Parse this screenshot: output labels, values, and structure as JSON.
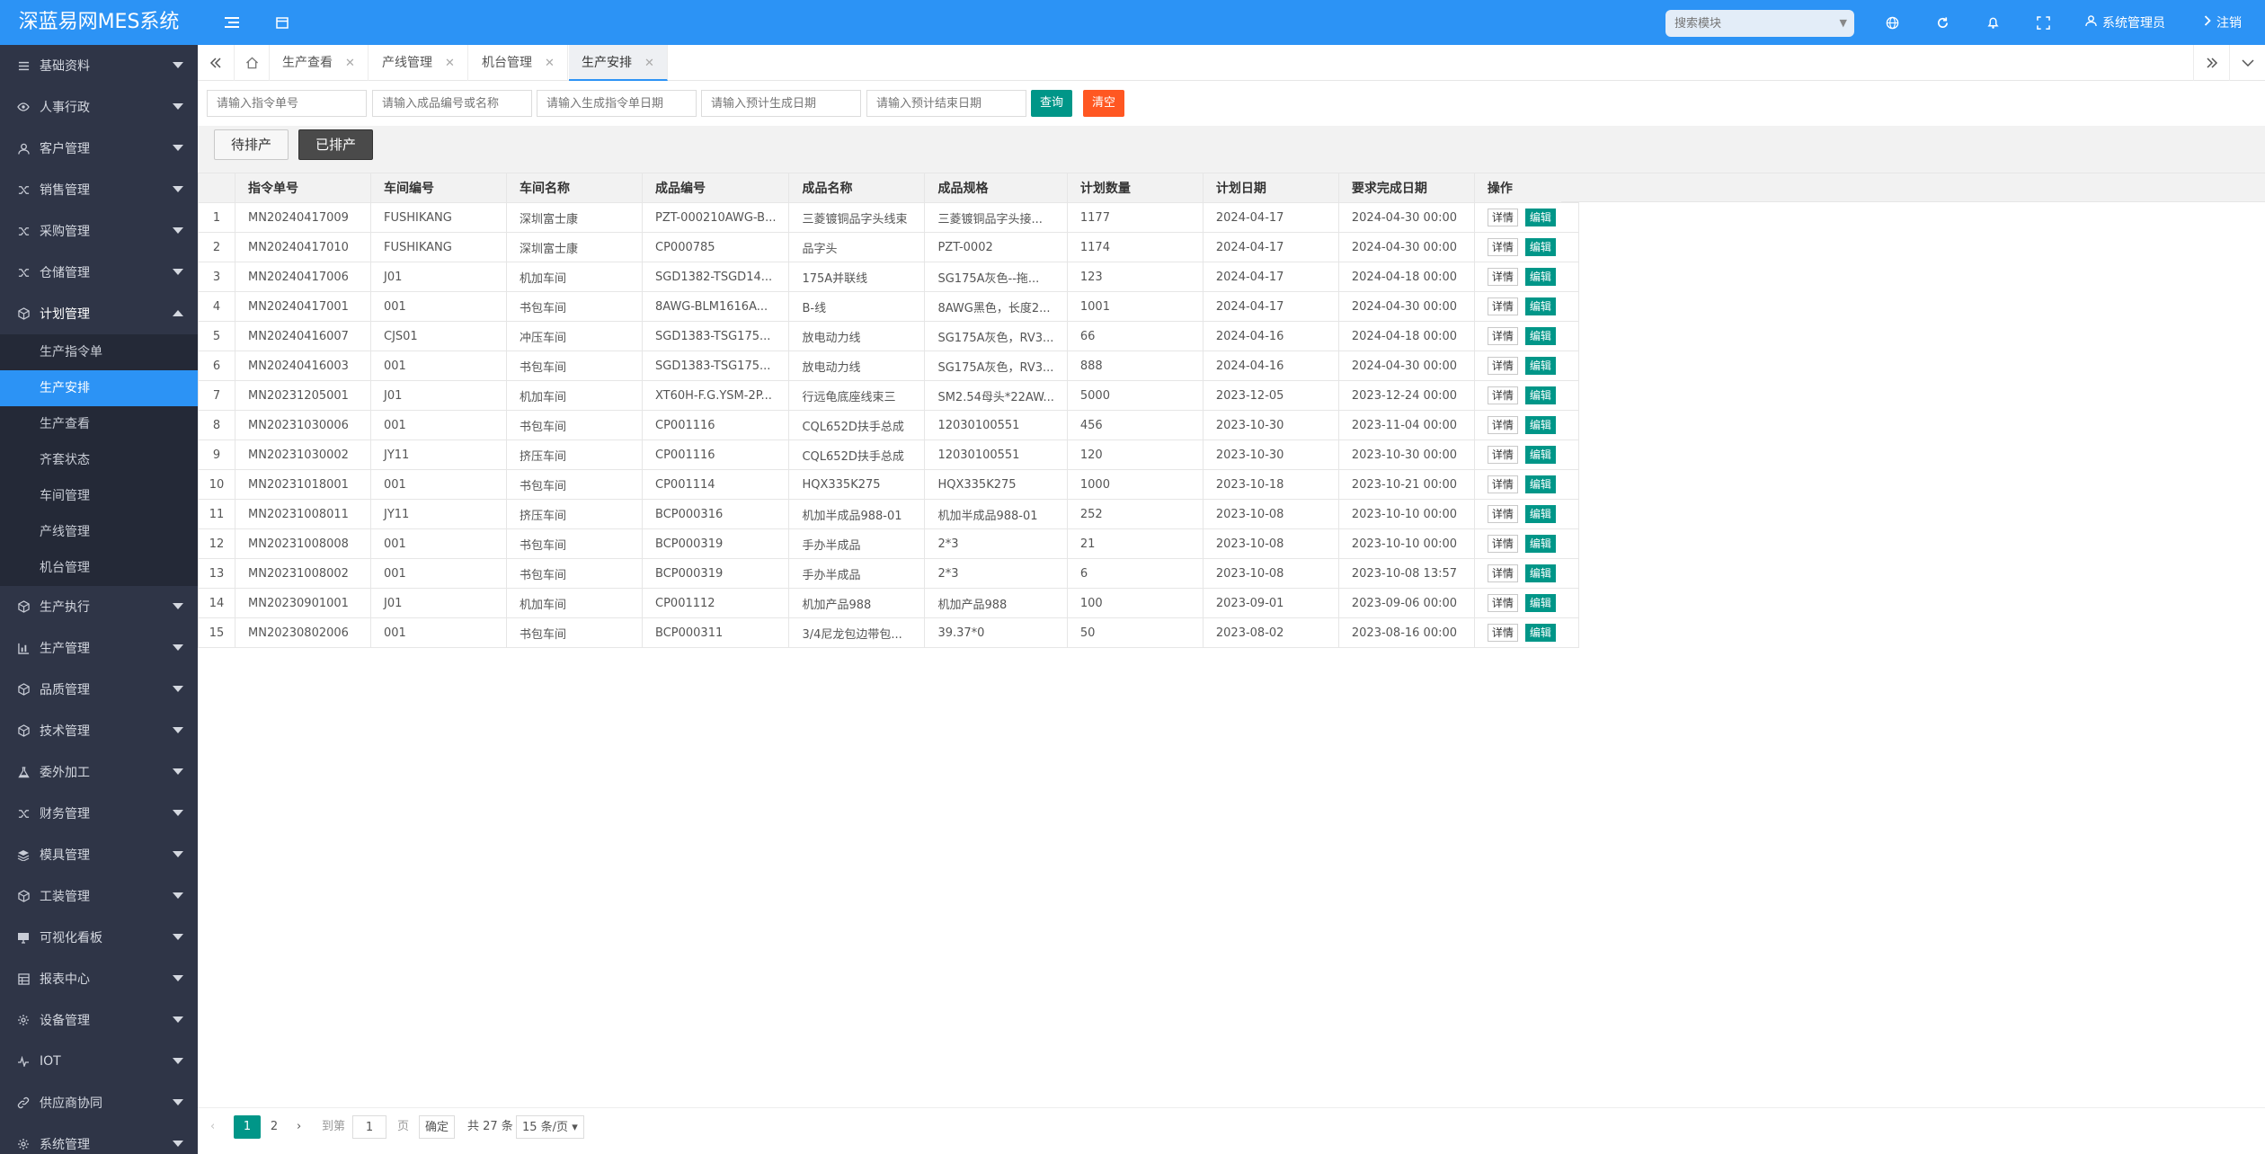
{
  "app": {
    "title": "深蓝易网MES系统"
  },
  "topbar": {
    "search_placeholder": "搜索模块",
    "user": "系统管理员",
    "logout": "注销",
    "icons": [
      "menu-toggle-icon",
      "calendar-icon",
      "globe-icon",
      "refresh-icon",
      "bell-icon",
      "fullscreen-icon",
      "user-icon"
    ]
  },
  "sidebar": {
    "items": [
      {
        "label": "基础资料",
        "icon": "list-icon"
      },
      {
        "label": "人事行政",
        "icon": "eye-icon"
      },
      {
        "label": "客户管理",
        "icon": "user-icon"
      },
      {
        "label": "销售管理",
        "icon": "shuffle-icon"
      },
      {
        "label": "采购管理",
        "icon": "shuffle-icon"
      },
      {
        "label": "仓储管理",
        "icon": "shuffle-icon"
      },
      {
        "label": "计划管理",
        "icon": "cube-icon"
      }
    ],
    "plan_submenu": [
      "生产指令单",
      "生产安排",
      "生产查看",
      "齐套状态",
      "车间管理",
      "产线管理",
      "机台管理"
    ],
    "active_sub": "生产安排",
    "items_after": [
      {
        "label": "生产执行",
        "icon": "cube-icon"
      },
      {
        "label": "生产管理",
        "icon": "chart-icon"
      },
      {
        "label": "品质管理",
        "icon": "cube-icon"
      },
      {
        "label": "技术管理",
        "icon": "cube-icon"
      },
      {
        "label": "委外加工",
        "icon": "flask-icon"
      },
      {
        "label": "财务管理",
        "icon": "shuffle-icon"
      },
      {
        "label": "模具管理",
        "icon": "layers-icon"
      },
      {
        "label": "工装管理",
        "icon": "cube-icon"
      },
      {
        "label": "可视化看板",
        "icon": "monitor-icon"
      },
      {
        "label": "报表中心",
        "icon": "table-icon"
      },
      {
        "label": "设备管理",
        "icon": "gear-icon"
      },
      {
        "label": "IOT",
        "icon": "pulse-icon"
      },
      {
        "label": "供应商协同",
        "icon": "link-icon"
      },
      {
        "label": "系统管理",
        "icon": "gear-icon"
      }
    ]
  },
  "tabs": [
    {
      "label": "生产查看"
    },
    {
      "label": "产线管理"
    },
    {
      "label": "机台管理"
    },
    {
      "label": "生产安排",
      "active": true
    }
  ],
  "filter": {
    "order_no_placeholder": "请输入指令单号",
    "product_placeholder": "请输入成品编号或名称",
    "create_date_placeholder": "请输入生成指令单日期",
    "plan_gen_date_placeholder": "请输入预计生成日期",
    "plan_end_date_placeholder": "请输入预计结束日期",
    "query_label": "查询",
    "clear_label": "清空"
  },
  "status_tabs": {
    "pending": "待排产",
    "scheduled": "已排产",
    "active": "scheduled"
  },
  "table": {
    "columns": [
      "指令单号",
      "车间编号",
      "车间名称",
      "成品编号",
      "成品名称",
      "成品规格",
      "计划数量",
      "计划日期",
      "要求完成日期",
      "操作"
    ],
    "detail_label": "详情",
    "edit_label": "编辑",
    "rows": [
      [
        "1",
        "MN20240417009",
        "FUSHIKANG",
        "深圳富士康",
        "PZT-000210AWG-B...",
        "三菱镀铜品字头线束",
        "三菱镀铜品字头接...",
        "1177",
        "2024-04-17",
        "2024-04-30 00:00"
      ],
      [
        "2",
        "MN20240417010",
        "FUSHIKANG",
        "深圳富士康",
        "CP000785",
        "品字头",
        "PZT-0002",
        "1174",
        "2024-04-17",
        "2024-04-30 00:00"
      ],
      [
        "3",
        "MN20240417006",
        "J01",
        "机加车间",
        "SGD1382-TSGD14...",
        "175A并联线",
        "SG175A灰色--拖...",
        "123",
        "2024-04-17",
        "2024-04-18 00:00"
      ],
      [
        "4",
        "MN20240417001",
        "001",
        "书包车间",
        "8AWG-BLM1616A...",
        "B-线",
        "8AWG黑色，长度2...",
        "1001",
        "2024-04-17",
        "2024-04-30 00:00"
      ],
      [
        "5",
        "MN20240416007",
        "CJS01",
        "冲压车间",
        "SGD1383-TSG175...",
        "放电动力线",
        "SG175A灰色，RV3...",
        "66",
        "2024-04-16",
        "2024-04-18 00:00"
      ],
      [
        "6",
        "MN20240416003",
        "001",
        "书包车间",
        "SGD1383-TSG175...",
        "放电动力线",
        "SG175A灰色，RV3...",
        "888",
        "2024-04-16",
        "2024-04-30 00:00"
      ],
      [
        "7",
        "MN20231205001",
        "J01",
        "机加车间",
        "XT60H-F.G.YSM-2P...",
        "行远龟底座线束三",
        "SM2.54母头*22AW...",
        "5000",
        "2023-12-05",
        "2023-12-24 00:00"
      ],
      [
        "8",
        "MN20231030006",
        "001",
        "书包车间",
        "CP001116",
        "CQL652D扶手总成",
        "12030100551",
        "456",
        "2023-10-30",
        "2023-11-04 00:00"
      ],
      [
        "9",
        "MN20231030002",
        "JY11",
        "挤压车间",
        "CP001116",
        "CQL652D扶手总成",
        "12030100551",
        "120",
        "2023-10-30",
        "2023-10-30 00:00"
      ],
      [
        "10",
        "MN20231018001",
        "001",
        "书包车间",
        "CP001114",
        "HQX335K275",
        "HQX335K275",
        "1000",
        "2023-10-18",
        "2023-10-21 00:00"
      ],
      [
        "11",
        "MN20231008011",
        "JY11",
        "挤压车间",
        "BCP000316",
        "机加半成品988-01",
        "机加半成品988-01",
        "252",
        "2023-10-08",
        "2023-10-10 00:00"
      ],
      [
        "12",
        "MN20231008008",
        "001",
        "书包车间",
        "BCP000319",
        "手办半成品",
        "2*3",
        "21",
        "2023-10-08",
        "2023-10-10 00:00"
      ],
      [
        "13",
        "MN20231008002",
        "001",
        "书包车间",
        "BCP000319",
        "手办半成品",
        "2*3",
        "6",
        "2023-10-08",
        "2023-10-08 13:57"
      ],
      [
        "14",
        "MN20230901001",
        "J01",
        "机加车间",
        "CP001112",
        "机加产品988",
        "机加产品988",
        "100",
        "2023-09-01",
        "2023-09-06 00:00"
      ],
      [
        "15",
        "MN20230802006",
        "001",
        "书包车间",
        "BCP000311",
        "3/4尼龙包边带包...",
        "39.37*0",
        "50",
        "2023-08-02",
        "2023-08-16 00:00"
      ]
    ]
  },
  "pager": {
    "pages": [
      "1",
      "2"
    ],
    "current": "1",
    "goto_label": "到第",
    "goto_value": "1",
    "page_unit": "页",
    "confirm": "确定",
    "total": "共 27 条",
    "page_size": "15 条/页"
  },
  "colors": {
    "primary": "#2c93f5",
    "sidebar_bg": "#2f3547",
    "teal": "#009688",
    "orange": "#ff5722"
  }
}
